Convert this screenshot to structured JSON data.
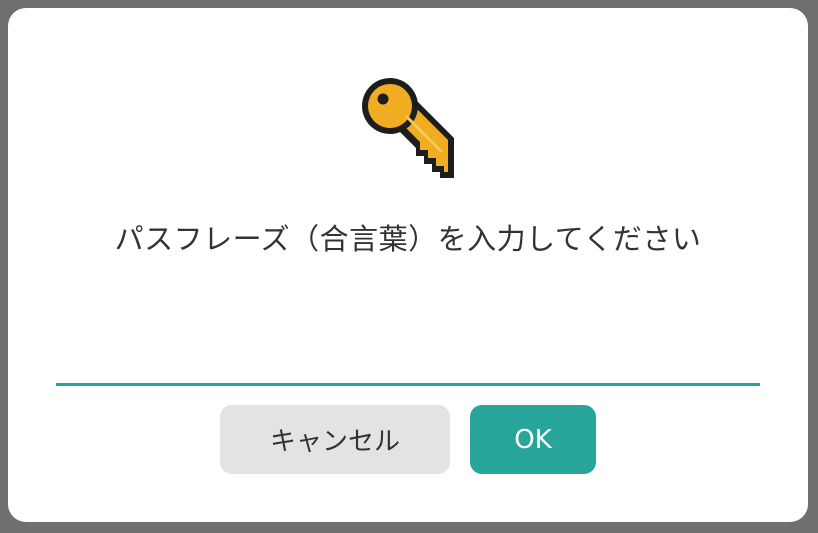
{
  "dialog": {
    "icon": "key-icon",
    "prompt": "パスフレーズ（合言葉）を入力してください",
    "input": {
      "value": "",
      "placeholder": ""
    },
    "buttons": {
      "cancel_label": "キャンセル",
      "ok_label": "OK"
    }
  },
  "colors": {
    "accent": "#27a59a",
    "cancel_bg": "#e3e3e3",
    "key_gold": "#f0ad22",
    "overlay": "#6f6f6f"
  }
}
